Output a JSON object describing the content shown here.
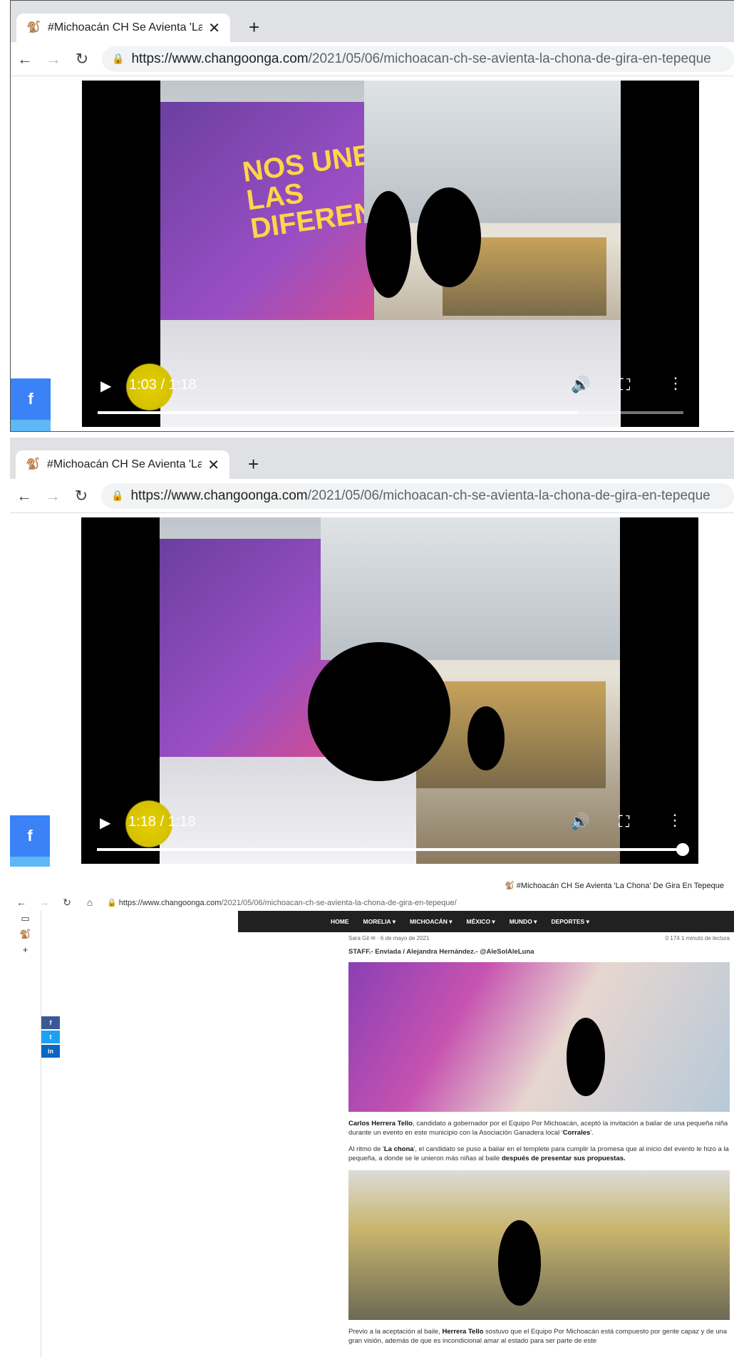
{
  "browser": {
    "tab_title": "#Michoacán CH Se Avienta 'La",
    "tab_title_fade": "",
    "favicon": "monkey-icon",
    "url_domain": "https://www.changoonga.com",
    "url_path": "/2021/05/06/michoacan-ch-se-avienta-la-chona-de-gira-en-tepeque"
  },
  "video1": {
    "time": "1:03 / 1:18",
    "progress": 0.82
  },
  "video2": {
    "time": "1:18 / 1:18",
    "progress": 1.0
  },
  "frame3": {
    "tab_title": "#Michoacán CH Se Avienta 'La Chona' De Gira En Tepeque",
    "url_domain": "https://www.changoonga.com",
    "url_path": "/2021/05/06/michoacan-ch-se-avienta-la-chona-de-gira-en-tepeque/",
    "nav": [
      "HOME",
      "MORELIA ▾",
      "MICHOACÁN ▾",
      "MÉXICO ▾",
      "MUNDO ▾",
      "DEPORTES ▾"
    ],
    "meta_left": "Sara Gil ✉ · 6 de mayo de 2021",
    "meta_right": "0   174   1 minuto de lectura",
    "staff": "STAFF.- Enviada / Alejandra Hernández.- @AleSolAleLuna",
    "p1_a": "Carlos Herrera Tello",
    "p1_b": ", candidato a gobernador por el Equipo Por Michoacán, aceptó la invitación a bailar de una pequeña niña durante un evento en este municipio con la Asociación Ganadera local '",
    "p1_c": "Corrales",
    "p1_d": "'.",
    "p2_a": "Al ritmo de '",
    "p2_b": "La chona",
    "p2_c": "', el candidato se puso a bailar en el templete para cumplir la promesa que al inicio del evento le hizo a la pequeña, a donde se le unieron más niñas al baile ",
    "p2_d": "después de presentar sus propuestas.",
    "p3_a": "Previo a la aceptación al baile, ",
    "p3_b": "Herrera Tello",
    "p3_c": " sostuvo que el Equipo Por Michoacán está compuesto por gente capaz y de una gran visión, además de que es incondicional amar al estado para ser parte de este"
  },
  "video_scene": {
    "banner_text": "NOS UNEN LAS DIFERENCIAS"
  },
  "colors": {
    "fb": "#3b82f6",
    "twitter": "#1da1f2",
    "linkedin": "#0a66c2"
  }
}
